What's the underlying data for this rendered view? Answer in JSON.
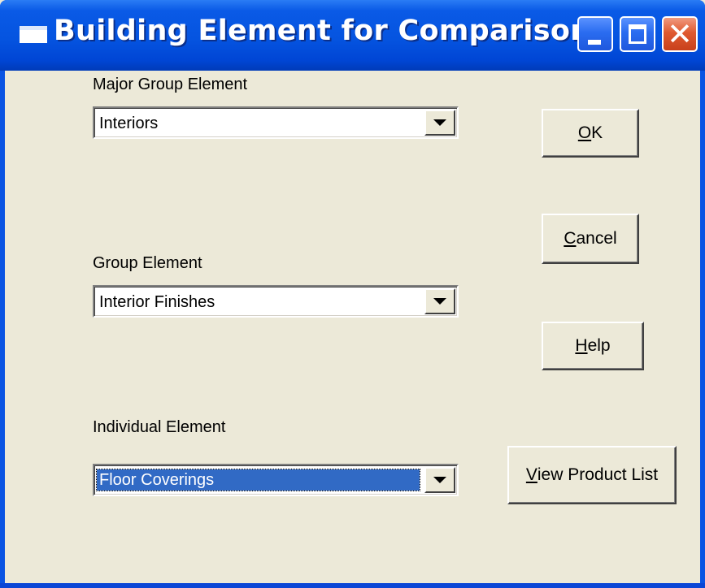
{
  "window": {
    "title": "Building Element for Comparison",
    "icons": {
      "app": "window-icon",
      "minimize": "minimize-icon",
      "maximize": "maximize-icon",
      "close": "close-icon"
    },
    "colors": {
      "titlebar": "#0054e3",
      "client": "#ece9d8",
      "selection": "#316ac5",
      "close": "#e05a30"
    }
  },
  "form": {
    "major_group": {
      "label": "Major Group Element",
      "value": "Interiors"
    },
    "group": {
      "label": "Group Element",
      "value": "Interior Finishes"
    },
    "individual": {
      "label": "Individual Element",
      "value": "Floor Coverings"
    }
  },
  "buttons": {
    "ok": {
      "label": "OK",
      "mnemonic": "O"
    },
    "cancel": {
      "label": "Cancel",
      "mnemonic": "C"
    },
    "help": {
      "label": "Help",
      "mnemonic": "H"
    },
    "view_products": {
      "label": "View Product List",
      "mnemonic": "V"
    }
  }
}
